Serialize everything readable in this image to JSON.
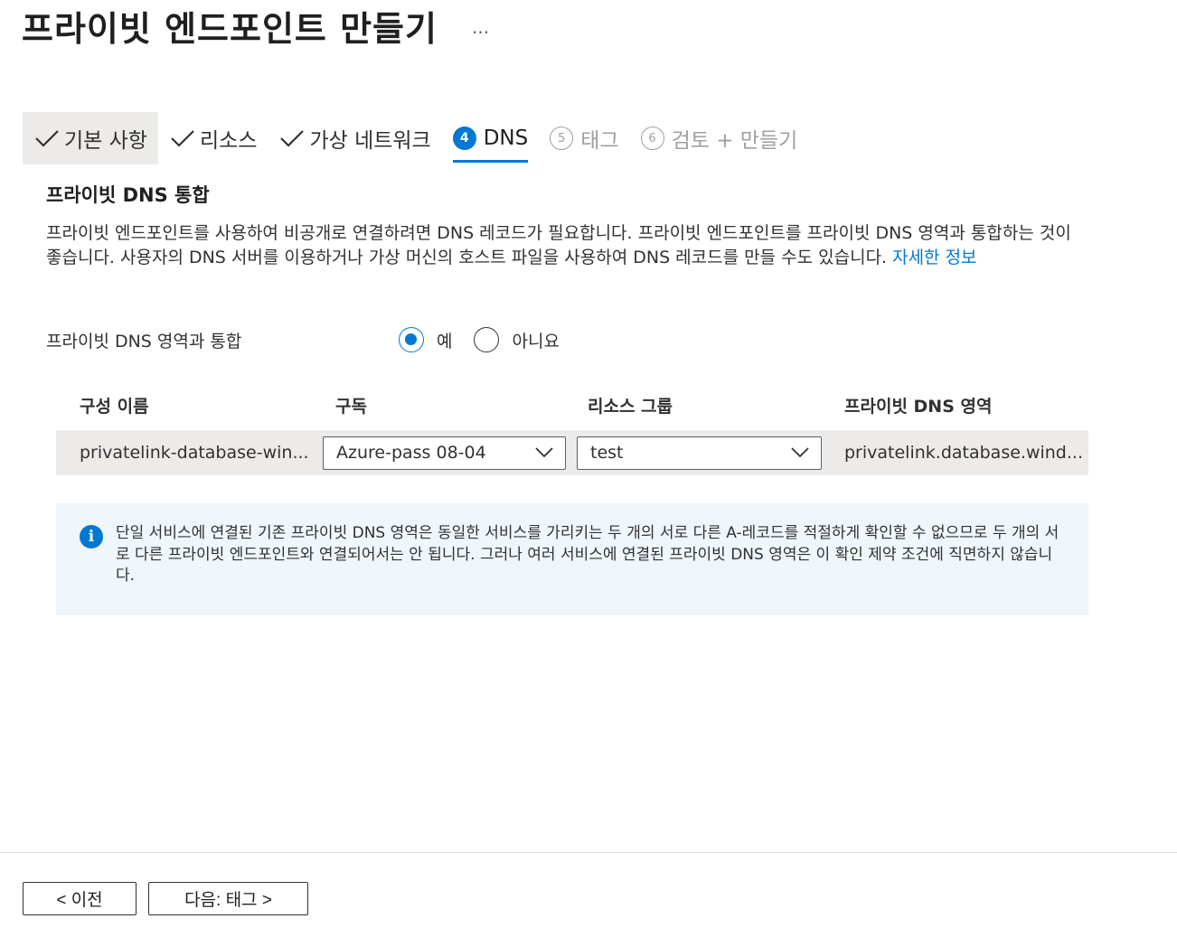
{
  "header": {
    "title": "프라이빗 엔드포인트 만들기",
    "more": "..."
  },
  "tabs": [
    {
      "label": "기본 사항",
      "state": "done"
    },
    {
      "label": "리소스",
      "state": "done"
    },
    {
      "label": "가상 네트워크",
      "state": "done"
    },
    {
      "number": "4",
      "label": "DNS",
      "state": "active"
    },
    {
      "number": "5",
      "label": "태그",
      "state": "pending"
    },
    {
      "number": "6",
      "label": "검토 + 만들기",
      "state": "pending"
    }
  ],
  "section": {
    "title": "프라이빗 DNS 통합",
    "description": "프라이빗 엔드포인트를 사용하여 비공개로 연결하려면 DNS 레코드가 필요합니다. 프라이빗 엔드포인트를 프라이빗 DNS 영역과 통합하는 것이 좋습니다. 사용자의 DNS 서버를 이용하거나 가상 머신의 호스트 파일을 사용하여 DNS 레코드를 만들 수도 있습니다.",
    "learn_more": "자세한 정보"
  },
  "integrate": {
    "label": "프라이빗 DNS 영역과 통합",
    "options": [
      "예",
      "아니요"
    ],
    "selected": "예"
  },
  "grid": {
    "headers": [
      "구성 이름",
      "구독",
      "리소스 그룹",
      "프라이빗 DNS 영역"
    ],
    "row": {
      "config_name": "privatelink-database-win...",
      "subscription": "Azure-pass 08-04",
      "resource_group": "test",
      "dns_zone": "privatelink.database.wind..."
    }
  },
  "info": {
    "text": "단일 서비스에 연결된 기존 프라이빗 DNS 영역은 동일한 서비스를 가리키는 두 개의 서로 다른 A-레코드를 적절하게 확인할 수 없으므로 두 개의 서로 다른 프라이빗 엔드포인트와 연결되어서는 안 됩니다. 그러나 여러 서비스에 연결된 프라이빗 DNS 영역은 이 확인 제약 조건에 직면하지 않습니다."
  },
  "footer": {
    "prev_label": "< 이전",
    "next_label": "다음: 태그 >"
  },
  "colors": {
    "accent": "#0078d4",
    "info_bg": "#eff6fc",
    "row_bg": "#edebe9"
  }
}
